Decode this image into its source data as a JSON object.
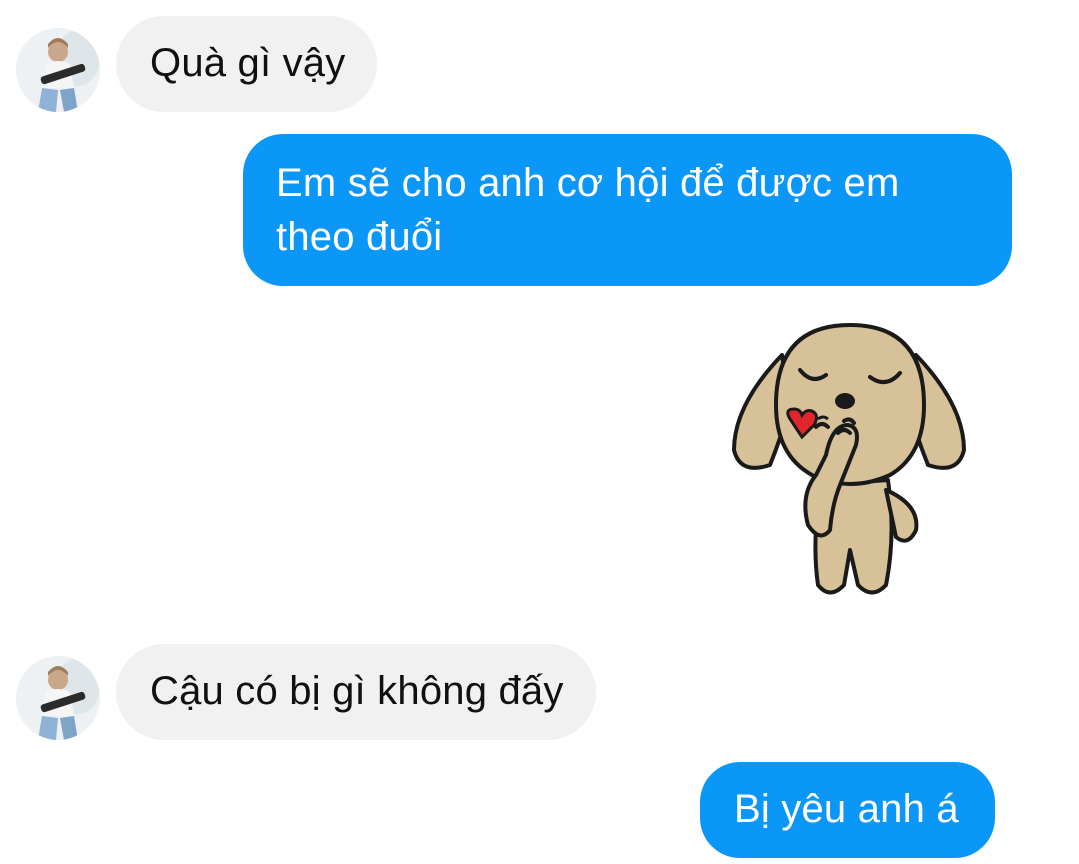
{
  "conversation": {
    "messages": [
      {
        "sender": "contact",
        "text": "Quà gì vậy"
      },
      {
        "sender": "me",
        "text": "Em sẽ cho anh cơ hội để được em theo đuổi"
      },
      {
        "sender": "me",
        "type": "sticker",
        "sticker": "puppy-blowing-kiss-heart"
      },
      {
        "sender": "contact",
        "text": "Cậu có bị gì không đấy"
      },
      {
        "sender": "me",
        "text": "Bị yêu anh á"
      }
    ]
  },
  "colors": {
    "outgoing_bubble": "#0a97f8",
    "incoming_bubble": "#f1f1f1",
    "background": "#ffffff"
  },
  "icons": {
    "contact_avatar": "avatar-person-with-guitar",
    "sticker": "puppy-blowing-kiss-heart"
  }
}
